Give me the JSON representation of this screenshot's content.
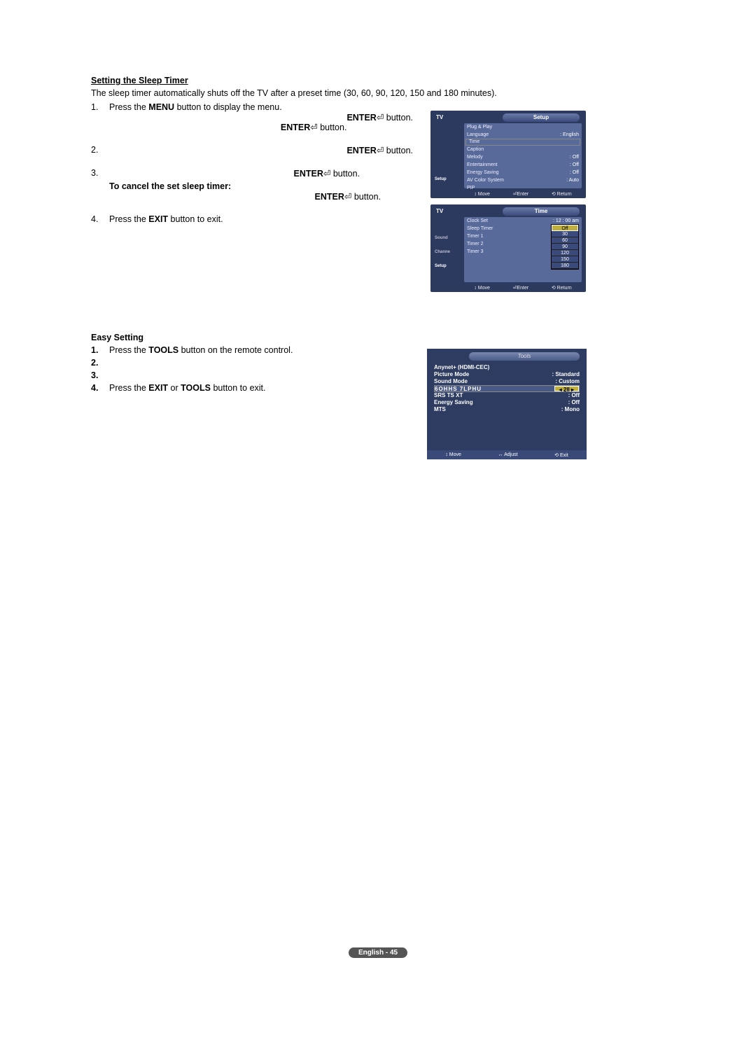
{
  "section1": {
    "title": "Setting the Sleep Timer",
    "intro": "The sleep timer automatically shuts off the TV after a preset time (30, 60, 90, 120, 150 and 180 minutes).",
    "step1_prefix": "Press the ",
    "step1_bold": "MENU",
    "step1_suffix": " button to display the menu.",
    "enter_word": "ENTER",
    "button_word": " button.",
    "cancel_line": "To cancel the set sleep timer:",
    "step4_prefix": "Press the ",
    "step4_bold": "EXIT",
    "step4_suffix": " button to exit."
  },
  "section2": {
    "title": "Easy Setting",
    "s1_prefix": "Press the ",
    "s1_bold": "TOOLS",
    "s1_suffix": " button on the remote control.",
    "s4_prefix": "Press the ",
    "s4_bold1": "EXIT",
    "s4_mid": " or ",
    "s4_bold2": "TOOLS",
    "s4_suffix": " button to exit."
  },
  "osd1": {
    "tv": "TV",
    "title": "Setup",
    "side1": "Setup",
    "rows": [
      {
        "l": "Plug & Play",
        "v": ""
      },
      {
        "l": "Language",
        "v": "English"
      },
      {
        "l": "Time",
        "v": ""
      },
      {
        "l": "Caption",
        "v": ""
      },
      {
        "l": "Melody",
        "v": "Off"
      },
      {
        "l": "Entertainment",
        "v": "Off"
      },
      {
        "l": "Energy Saving",
        "v": "Off"
      },
      {
        "l": "AV Color System",
        "v": "Auto"
      },
      {
        "l": "PIP",
        "v": ""
      }
    ],
    "bottom": {
      "a": "Move",
      "b": "Enter",
      "c": "Return"
    }
  },
  "osd2": {
    "tv": "TV",
    "title": "Time",
    "side": [
      "",
      "Sound",
      "Channe",
      "Setup"
    ],
    "rows": [
      {
        "l": "Clock Set",
        "v": "12 : 00 am"
      },
      {
        "l": "Sleep Timer",
        "v": "Off"
      },
      {
        "l": "Timer 1",
        "v": ""
      },
      {
        "l": "Timer 2",
        "v": ""
      },
      {
        "l": "Timer 3",
        "v": ""
      }
    ],
    "dropdown": [
      "Off",
      "30",
      "60",
      "90",
      "120",
      "150",
      "180"
    ],
    "bottom": {
      "a": "Move",
      "b": "Enter",
      "c": "Return"
    }
  },
  "tools": {
    "title": "Tools",
    "rows": [
      {
        "l": "Anynet+ (HDMI-CEC)",
        "v": ""
      },
      {
        "l": "Picture Mode",
        "v": "Standard"
      },
      {
        "l": "Sound Mode",
        "v": "Custom"
      }
    ],
    "hl": {
      "l": "6OHHS 7LPHU",
      "v": "2II"
    },
    "rows2": [
      {
        "l": "SRS TS XT",
        "v": "Off"
      },
      {
        "l": "Energy Saving",
        "v": "Off"
      },
      {
        "l": "MTS",
        "v": "Mono"
      }
    ],
    "bottom": {
      "a": "Move",
      "b": "Adjust",
      "c": "Exit"
    }
  },
  "footer": "English - 45"
}
